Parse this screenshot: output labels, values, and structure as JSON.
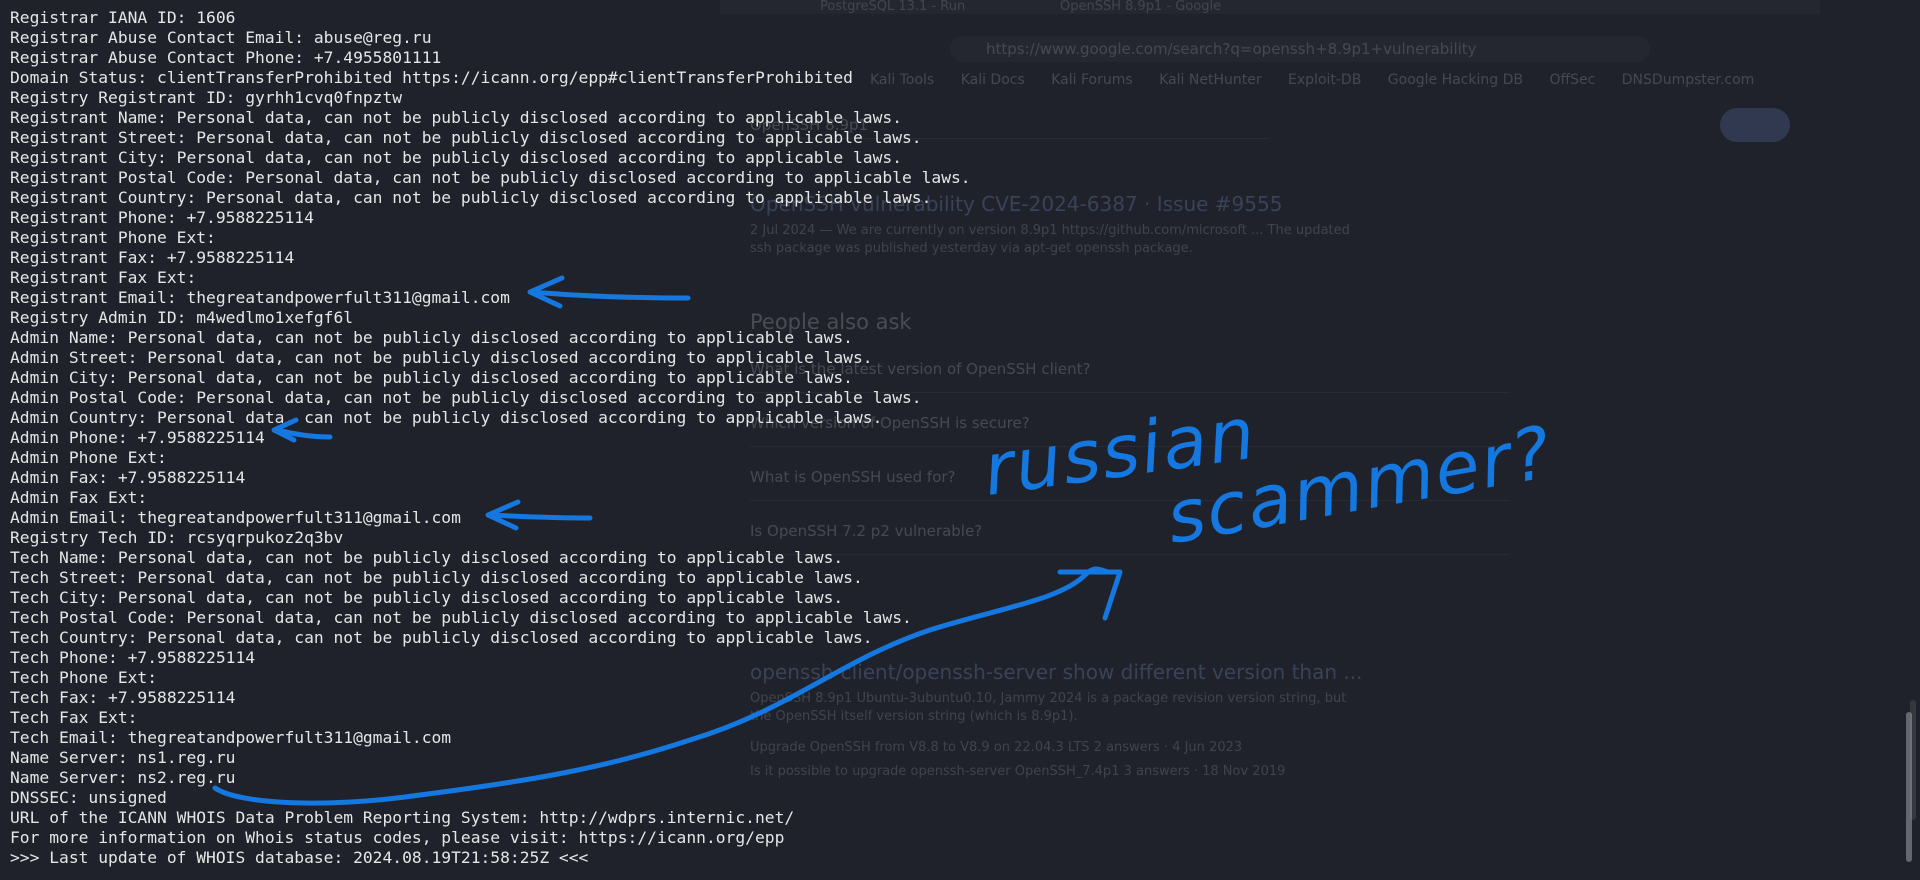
{
  "background_browser": {
    "tabs": [
      "PostgreSQL 13.1 - Run",
      "OpenSSH 8.9p1 - Google"
    ],
    "url": "https://www.google.com/search?q=openssh+8.9p1+vulnerability",
    "bookmarks": [
      "Kali Tools",
      "Kali Docs",
      "Kali Forums",
      "Kali NetHunter",
      "Exploit-DB",
      "Google Hacking DB",
      "OffSec",
      "DNSDumpster.com"
    ],
    "search_query": "OpenSSH 8.9p1",
    "results": [
      {
        "title": "OpenSSH vulnerability CVE-2024-6387 · Issue #9555",
        "snippet": "2 Jul 2024 — We are currently on version 8.9p1 https://github.com/microsoft ... The updated ssh package was published yesterday via apt-get openssh package."
      },
      {
        "title": "openssh-client/openssh-server show different version than ...",
        "snippet": "OpenSSH 8.9p1 Ubuntu-3ubuntu0.10, Jammy 2024 is a package revision version string, but the OpenSSH itself version string (which is 8.9p1)."
      }
    ],
    "people_also_ask": {
      "heading": "People also ask",
      "questions": [
        "What is the latest version of OpenSSH client?",
        "Which version of OpenSSH is secure?",
        "What is OpenSSH used for?",
        "Is OpenSSH 7.2 p2 vulnerable?"
      ]
    },
    "related_rows": [
      "Upgrade OpenSSH from V8.8 to V8.9 on 22.04.3 LTS    2 answers · 4 Jun 2023",
      "Is it possible to upgrade openssh-server OpenSSH_7.4p1    3 answers · 18 Nov 2019"
    ]
  },
  "terminal": {
    "lines": [
      "Registrar IANA ID: 1606",
      "Registrar Abuse Contact Email: abuse@reg.ru",
      "Registrar Abuse Contact Phone: +7.4955801111",
      "Domain Status: clientTransferProhibited https://icann.org/epp#clientTransferProhibited",
      "Registry Registrant ID: gyrhh1cvq0fnpztw",
      "Registrant Name: Personal data, can not be publicly disclosed according to applicable laws.",
      "Registrant Street: Personal data, can not be publicly disclosed according to applicable laws.",
      "Registrant City: Personal data, can not be publicly disclosed according to applicable laws.",
      "Registrant Postal Code: Personal data, can not be publicly disclosed according to applicable laws.",
      "Registrant Country: Personal data, can not be publicly disclosed according to applicable laws.",
      "Registrant Phone: +7.9588225114",
      "Registrant Phone Ext:",
      "Registrant Fax: +7.9588225114",
      "Registrant Fax Ext:",
      "Registrant Email: thegreatandpowerfult311@gmail.com",
      "Registry Admin ID: m4wedlmo1xefgf6l",
      "Admin Name: Personal data, can not be publicly disclosed according to applicable laws.",
      "Admin Street: Personal data, can not be publicly disclosed according to applicable laws.",
      "Admin City: Personal data, can not be publicly disclosed according to applicable laws.",
      "Admin Postal Code: Personal data, can not be publicly disclosed according to applicable laws.",
      "Admin Country: Personal data, can not be publicly disclosed according to applicable laws.",
      "Admin Phone: +7.9588225114",
      "Admin Phone Ext:",
      "Admin Fax: +7.9588225114",
      "Admin Fax Ext:",
      "Admin Email: thegreatandpowerfult311@gmail.com",
      "Registry Tech ID: rcsyqrpukoz2q3bv",
      "Tech Name: Personal data, can not be publicly disclosed according to applicable laws.",
      "Tech Street: Personal data, can not be publicly disclosed according to applicable laws.",
      "Tech City: Personal data, can not be publicly disclosed according to applicable laws.",
      "Tech Postal Code: Personal data, can not be publicly disclosed according to applicable laws.",
      "Tech Country: Personal data, can not be publicly disclosed according to applicable laws.",
      "Tech Phone: +7.9588225114",
      "Tech Phone Ext:",
      "Tech Fax: +7.9588225114",
      "Tech Fax Ext:",
      "Tech Email: thegreatandpowerfult311@gmail.com",
      "Name Server: ns1.reg.ru",
      "Name Server: ns2.reg.ru",
      "DNSSEC: unsigned",
      "URL of the ICANN WHOIS Data Problem Reporting System: http://wdprs.internic.net/",
      "For more information on Whois status codes, please visit: https://icann.org/epp",
      ">>> Last update of WHOIS database: 2024.08.19T21:58:25Z <<<"
    ],
    "colors": {
      "background": "#1f222a",
      "text": "#e6e6e6"
    }
  },
  "annotation": {
    "color": "#1478e0",
    "word1": "russian",
    "word2": "scammer?"
  }
}
